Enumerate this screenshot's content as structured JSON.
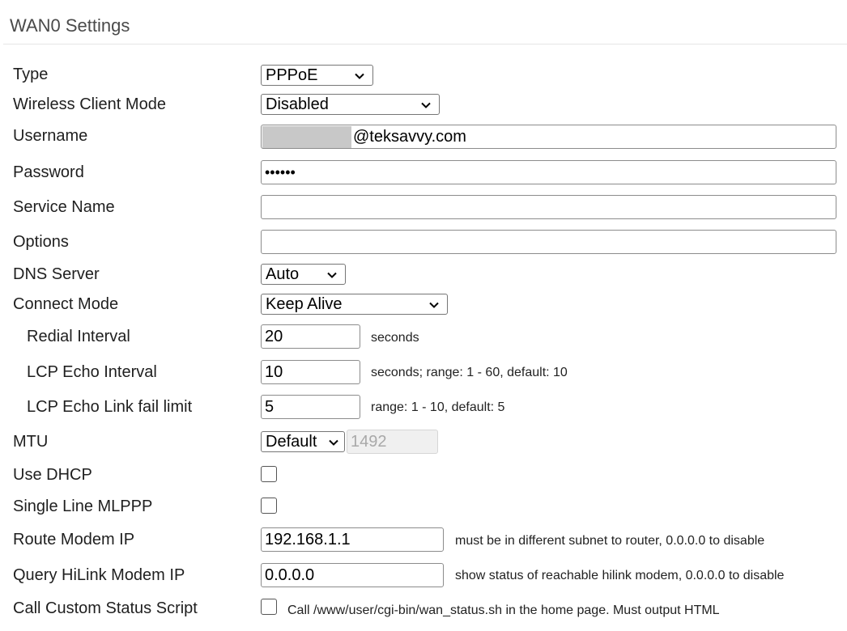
{
  "section": {
    "title": "WAN0 Settings"
  },
  "fields": {
    "type": {
      "label": "Type",
      "value": "PPPoE"
    },
    "wireless_client_mode": {
      "label": "Wireless Client Mode",
      "value": "Disabled"
    },
    "username": {
      "label": "Username",
      "value": "@teksavvy.com"
    },
    "password": {
      "label": "Password",
      "value": "••••••"
    },
    "service_name": {
      "label": "Service Name",
      "value": ""
    },
    "options": {
      "label": "Options",
      "value": ""
    },
    "dns_server": {
      "label": "DNS Server",
      "value": "Auto"
    },
    "connect_mode": {
      "label": "Connect Mode",
      "value": "Keep Alive"
    },
    "redial_interval": {
      "label": "Redial Interval",
      "value": "20",
      "hint": "seconds"
    },
    "lcp_echo_interval": {
      "label": "LCP Echo Interval",
      "value": "10",
      "hint": "seconds; range: 1 - 60, default: 10"
    },
    "lcp_echo_fail_limit": {
      "label": "LCP Echo Link fail limit",
      "value": "5",
      "hint": "range: 1 - 10, default: 5"
    },
    "mtu": {
      "label": "MTU",
      "value": "Default",
      "custom_value": "1492"
    },
    "use_dhcp": {
      "label": "Use DHCP",
      "checked": false
    },
    "single_line_mlppp": {
      "label": "Single Line MLPPP",
      "checked": false
    },
    "route_modem_ip": {
      "label": "Route Modem IP",
      "value": "192.168.1.1",
      "hint": "must be in different subnet to router, 0.0.0.0 to disable"
    },
    "query_hilink_modem_ip": {
      "label": "Query HiLink Modem IP",
      "value": "0.0.0.0",
      "hint": "show status of reachable hilink modem, 0.0.0.0 to disable"
    },
    "call_custom_status_script": {
      "label": "Call Custom Status Script",
      "checked": false,
      "hint": "Call /www/user/cgi-bin/wan_status.sh in the home page. Must output HTML"
    }
  },
  "icons": {
    "dropdown": "chevron-down-icon"
  }
}
